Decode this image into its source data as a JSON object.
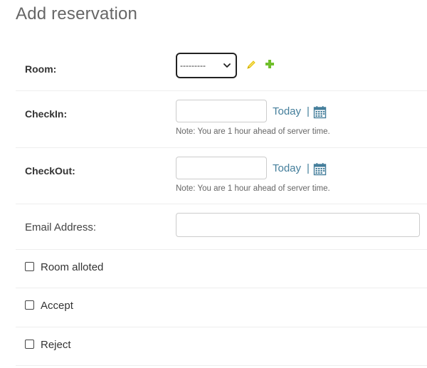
{
  "page": {
    "title": "Add reservation"
  },
  "room": {
    "label": "Room:",
    "selected": "---------",
    "edit_icon": "pencil-icon",
    "add_icon": "plus-icon",
    "accent_edit": "#e6c300",
    "accent_add": "#70bf2b"
  },
  "checkin": {
    "label": "CheckIn:",
    "value": "",
    "today_label": "Today",
    "separator": "|",
    "calendar_icon": "calendar-icon",
    "note": "Note: You are 1 hour ahead of server time."
  },
  "checkout": {
    "label": "CheckOut:",
    "value": "",
    "today_label": "Today",
    "separator": "|",
    "calendar_icon": "calendar-icon",
    "note": "Note: You are 1 hour ahead of server time."
  },
  "email": {
    "label": "Email Address:",
    "value": ""
  },
  "checkboxes": [
    {
      "label": "Room alloted",
      "checked": false
    },
    {
      "label": "Accept",
      "checked": false
    },
    {
      "label": "Reject",
      "checked": false
    }
  ],
  "colors": {
    "link": "#447e9b",
    "border": "#cccccc",
    "divider": "#eeeeee"
  }
}
